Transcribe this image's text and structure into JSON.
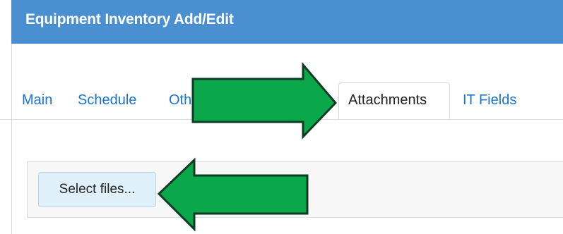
{
  "window": {
    "title": "Equipment Inventory Add/Edit",
    "header_color": "#4a8fd0"
  },
  "tabs": {
    "items": [
      {
        "label": "Main"
      },
      {
        "label": "Schedule"
      },
      {
        "label": "Other"
      },
      {
        "label": "Attachments",
        "active": true
      },
      {
        "label": "IT Fields"
      }
    ],
    "link_color": "#1a73d1"
  },
  "attachments": {
    "select_files_label": "Select files..."
  },
  "annotations": {
    "arrow_color": "#0aa84a",
    "arrow_outline_color": "#0c3d24"
  }
}
